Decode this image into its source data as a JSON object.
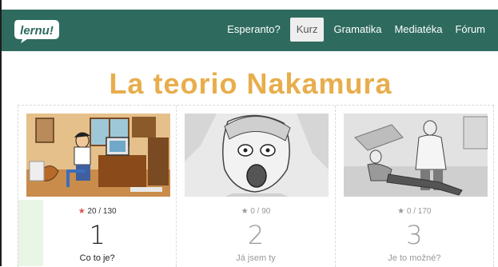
{
  "nav": {
    "logo_text": "lernu!",
    "items": [
      {
        "label": "Esperanto?",
        "active": false
      },
      {
        "label": "Kurz",
        "active": true
      },
      {
        "label": "Gramatika",
        "active": false
      },
      {
        "label": "Mediatéka",
        "active": false
      },
      {
        "label": "Fórum",
        "active": false
      }
    ]
  },
  "page_title": "La teorio Nakamura",
  "cards": [
    {
      "rating": "20 / 130",
      "number": "1",
      "label": "Co to je?"
    },
    {
      "rating": "0 / 90",
      "number": "2",
      "label": "Já jsem ty"
    },
    {
      "rating": "0 / 170",
      "number": "3",
      "label": "Je to možné?"
    }
  ],
  "colors": {
    "navbar": "#2e6b5e",
    "title": "#e8ad4c",
    "star_active": "#d9534f"
  }
}
